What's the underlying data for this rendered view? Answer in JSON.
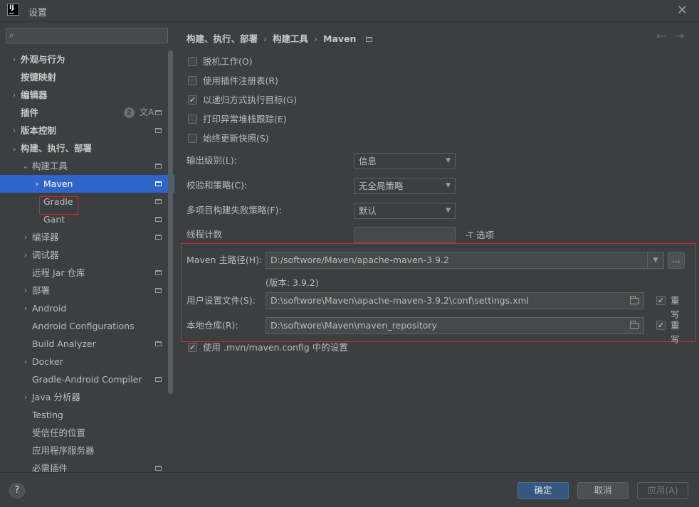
{
  "window": {
    "title": "设置",
    "logo": "IJ"
  },
  "search": {
    "placeholder": ""
  },
  "sidebar": {
    "items": [
      {
        "label": "外观与行为",
        "bold": true,
        "chevron": "›",
        "indent": 0,
        "proj": false
      },
      {
        "label": "按键映射",
        "bold": true,
        "chevron": "",
        "indent": 0,
        "proj": false
      },
      {
        "label": "编辑器",
        "bold": true,
        "chevron": "›",
        "indent": 0,
        "proj": false
      },
      {
        "label": "插件",
        "bold": true,
        "chevron": "",
        "indent": 0,
        "proj": true,
        "badge": "2"
      },
      {
        "label": "版本控制",
        "bold": true,
        "chevron": "›",
        "indent": 0,
        "proj": true
      },
      {
        "label": "构建、执行、部署",
        "bold": true,
        "chevron": "⌄",
        "indent": 0,
        "proj": false
      },
      {
        "label": "构建工具",
        "bold": false,
        "chevron": "⌄",
        "indent": 1,
        "proj": true
      },
      {
        "label": "Maven",
        "bold": false,
        "chevron": "›",
        "indent": 2,
        "proj": true,
        "selected": true
      },
      {
        "label": "Gradle",
        "bold": false,
        "chevron": "",
        "indent": 2,
        "proj": true
      },
      {
        "label": "Gant",
        "bold": false,
        "chevron": "",
        "indent": 2,
        "proj": true
      },
      {
        "label": "编译器",
        "bold": false,
        "chevron": "›",
        "indent": 1,
        "proj": true
      },
      {
        "label": "调试器",
        "bold": false,
        "chevron": "›",
        "indent": 1,
        "proj": false
      },
      {
        "label": "远程 Jar 仓库",
        "bold": false,
        "chevron": "",
        "indent": 1,
        "proj": true
      },
      {
        "label": "部署",
        "bold": false,
        "chevron": "›",
        "indent": 1,
        "proj": true
      },
      {
        "label": "Android",
        "bold": false,
        "chevron": "›",
        "indent": 1,
        "proj": false
      },
      {
        "label": "Android Configurations",
        "bold": false,
        "chevron": "",
        "indent": 1,
        "proj": false
      },
      {
        "label": "Build Analyzer",
        "bold": false,
        "chevron": "",
        "indent": 1,
        "proj": true
      },
      {
        "label": "Docker",
        "bold": false,
        "chevron": "›",
        "indent": 1,
        "proj": false
      },
      {
        "label": "Gradle-Android Compiler",
        "bold": false,
        "chevron": "",
        "indent": 1,
        "proj": true
      },
      {
        "label": "Java 分析器",
        "bold": false,
        "chevron": "›",
        "indent": 1,
        "proj": false
      },
      {
        "label": "Testing",
        "bold": false,
        "chevron": "",
        "indent": 1,
        "proj": false
      },
      {
        "label": "受信任的位置",
        "bold": false,
        "chevron": "",
        "indent": 1,
        "proj": false
      },
      {
        "label": "应用程序服务器",
        "bold": false,
        "chevron": "",
        "indent": 1,
        "proj": false
      },
      {
        "label": "必需插件",
        "bold": false,
        "chevron": "",
        "indent": 1,
        "proj": true
      }
    ]
  },
  "breadcrumb": {
    "part1": "构建、执行、部署",
    "part2": "构建工具",
    "part3": "Maven",
    "sep": "›"
  },
  "options": {
    "offline": {
      "label": "脱机工作(O)",
      "checked": false
    },
    "plugin_registry": {
      "label": "使用插件注册表(R)",
      "checked": false
    },
    "recursive": {
      "label": "以递归方式执行目标(G)",
      "checked": true
    },
    "stack_trace": {
      "label": "打印异常堆栈跟踪(E)",
      "checked": false
    },
    "update_snapshots": {
      "label": "始终更新快照(S)",
      "checked": false
    }
  },
  "form": {
    "output_level": {
      "label": "输出级别(L):",
      "value": "信息"
    },
    "checksum": {
      "label": "校验和策略(C):",
      "value": "无全局策略"
    },
    "multiproject": {
      "label": "多项目构建失败策略(F):",
      "value": "默认"
    },
    "threads": {
      "label": "线程计数",
      "value": "",
      "suffix": "-T 选项"
    }
  },
  "maven": {
    "home_label": "Maven 主路径(H):",
    "home_value": "D:/softwore/Maven/apache-maven-3.9.2",
    "browse_label": "...",
    "version": "(版本: 3.9.2)",
    "settings_label": "用户设置文件(S):",
    "settings_value": "D:\\softwore\\Maven\\apache-maven-3.9.2\\conf\\settings.xml",
    "settings_override": "重写",
    "repo_label": "本地仓库(R):",
    "repo_value": "D:\\softwore\\Maven\\maven_repository",
    "repo_override": "重写",
    "mvn_config_label": "使用 .mvn/maven.config 中的设置"
  },
  "footer": {
    "help": "?",
    "ok": "确定",
    "cancel": "取消",
    "apply": "应用(A)"
  },
  "icons": {
    "close": "close-icon",
    "search": "search-icon",
    "back": "arrow-left-icon",
    "forward": "arrow-right-icon"
  },
  "colors": {
    "accent": "#2f65ca",
    "highlight": "#d8252a",
    "ok_button": "#365880"
  }
}
